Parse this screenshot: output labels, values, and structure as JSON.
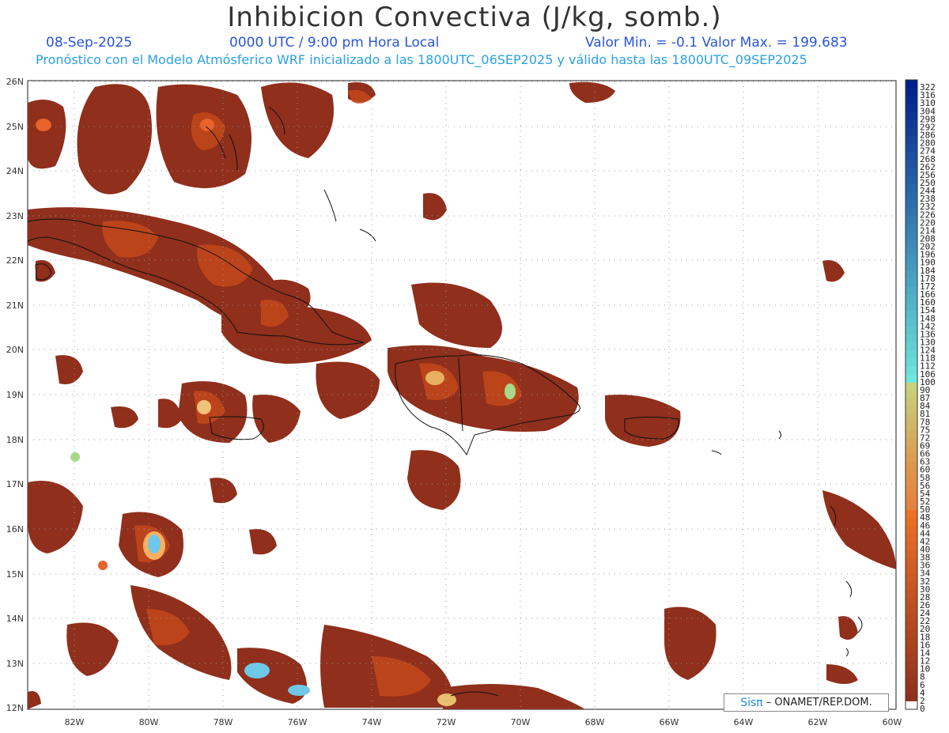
{
  "title": "Inhibicion Convectiva (J/kg, somb.)",
  "date": "08-Sep-2025",
  "time": "0000 UTC / 9:00 pm Hora Local",
  "min_max": "Valor Min. = -0.1  Valor Max. = 199.683",
  "forecast_info": "Pronóstico con el Modelo Atmósferico WRF inicializado a las 1800UTC_06SEP2025 y válido hasta las  1800UTC_09SEP2025",
  "credit": {
    "brand": "Sisπ",
    "text": "– ONAMET/REP.DOM."
  },
  "lon_labels": [
    "82W",
    "80W",
    "78W",
    "76W",
    "74W",
    "72W",
    "70W",
    "68W",
    "66W",
    "64W",
    "62W",
    "60W"
  ],
  "lat_labels": [
    "26N",
    "25N",
    "24N",
    "23N",
    "22N",
    "21N",
    "20N",
    "19N",
    "18N",
    "17N",
    "16N",
    "15N",
    "14N",
    "13N",
    "12N"
  ],
  "colorbar_labels": [
    "322",
    "316",
    "310",
    "304",
    "298",
    "292",
    "286",
    "280",
    "274",
    "268",
    "262",
    "256",
    "250",
    "244",
    "238",
    "232",
    "226",
    "220",
    "214",
    "208",
    "202",
    "196",
    "190",
    "184",
    "178",
    "172",
    "166",
    "160",
    "154",
    "148",
    "142",
    "136",
    "130",
    "124",
    "118",
    "112",
    "106",
    "100",
    "90",
    "87",
    "84",
    "81",
    "78",
    "75",
    "72",
    "69",
    "66",
    "63",
    "60",
    "58",
    "56",
    "54",
    "52",
    "50",
    "48",
    "46",
    "44",
    "42",
    "40",
    "38",
    "36",
    "34",
    "32",
    "30",
    "28",
    "26",
    "24",
    "22",
    "20",
    "18",
    "16",
    "14",
    "12",
    "10",
    "8",
    "6",
    "4",
    "2",
    "0"
  ],
  "colors": {
    "cin_dark": "#8f2f1c",
    "cin_mid": "#c4481a",
    "cin_high": "#e9622a",
    "cin_peak": "#6ec9e8",
    "coast": "#111111"
  }
}
